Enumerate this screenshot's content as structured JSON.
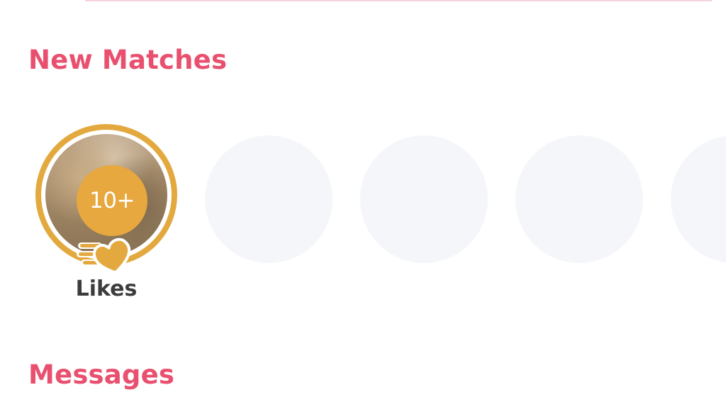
{
  "sections": {
    "new_matches_title": "New Matches",
    "messages_title": "Messages"
  },
  "likes_tile": {
    "count_label": "10+",
    "label": "Likes",
    "icon": "heart-speed-icon"
  },
  "new_matches": {
    "placeholder_count": 4
  },
  "colors": {
    "accent": "#e9506f",
    "gold": "#e3a93f",
    "placeholder": "#f4f6fa",
    "text_dark": "#3c3c3c"
  }
}
